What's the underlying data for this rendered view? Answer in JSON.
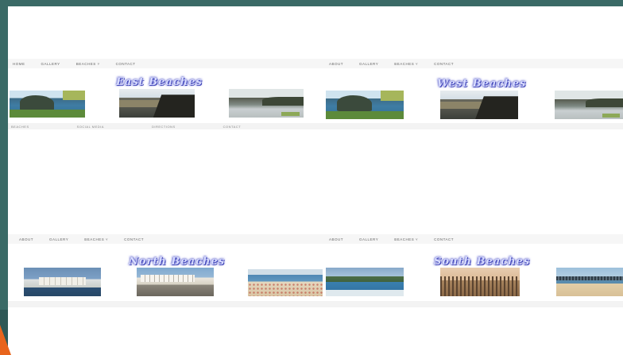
{
  "panels": {
    "east": {
      "title": "East Beaches",
      "nav": [
        "HOME",
        "GALLERY",
        "BEACHES ˅",
        "CONTACT"
      ],
      "footer": [
        "BEACHES",
        "SOCIAL MEDIA",
        "DIRECTIONS",
        "CONTACT"
      ],
      "photos": [
        "coast-photo",
        "cliff-photo",
        "shore-photo"
      ]
    },
    "west": {
      "title": "West Beaches",
      "nav": [
        "ABOUT",
        "GALLERY",
        "BEACHES ˅",
        "CONTACT"
      ],
      "photos": [
        "coast-photo",
        "cliff-photo",
        "shore-photo"
      ]
    },
    "north": {
      "title": "North Beaches",
      "nav": [
        "ABOUT",
        "GALLERY",
        "BEACHES ˅",
        "CONTACT"
      ],
      "photos": [
        "town-photo",
        "promenade-photo",
        "busy-beach-photo"
      ]
    },
    "south": {
      "title": "South Beaches",
      "nav": [
        "ABOUT",
        "GALLERY",
        "BEACHES ˅",
        "CONTACT"
      ],
      "photos": [
        "bay-photo",
        "fence-photo",
        "pier-photo"
      ]
    }
  },
  "colors": {
    "frame_bg": "#3a6a66",
    "slide_bg": "#ffffff",
    "accent_corner": "#e8641c",
    "title_glow": "#3a3fb0"
  }
}
